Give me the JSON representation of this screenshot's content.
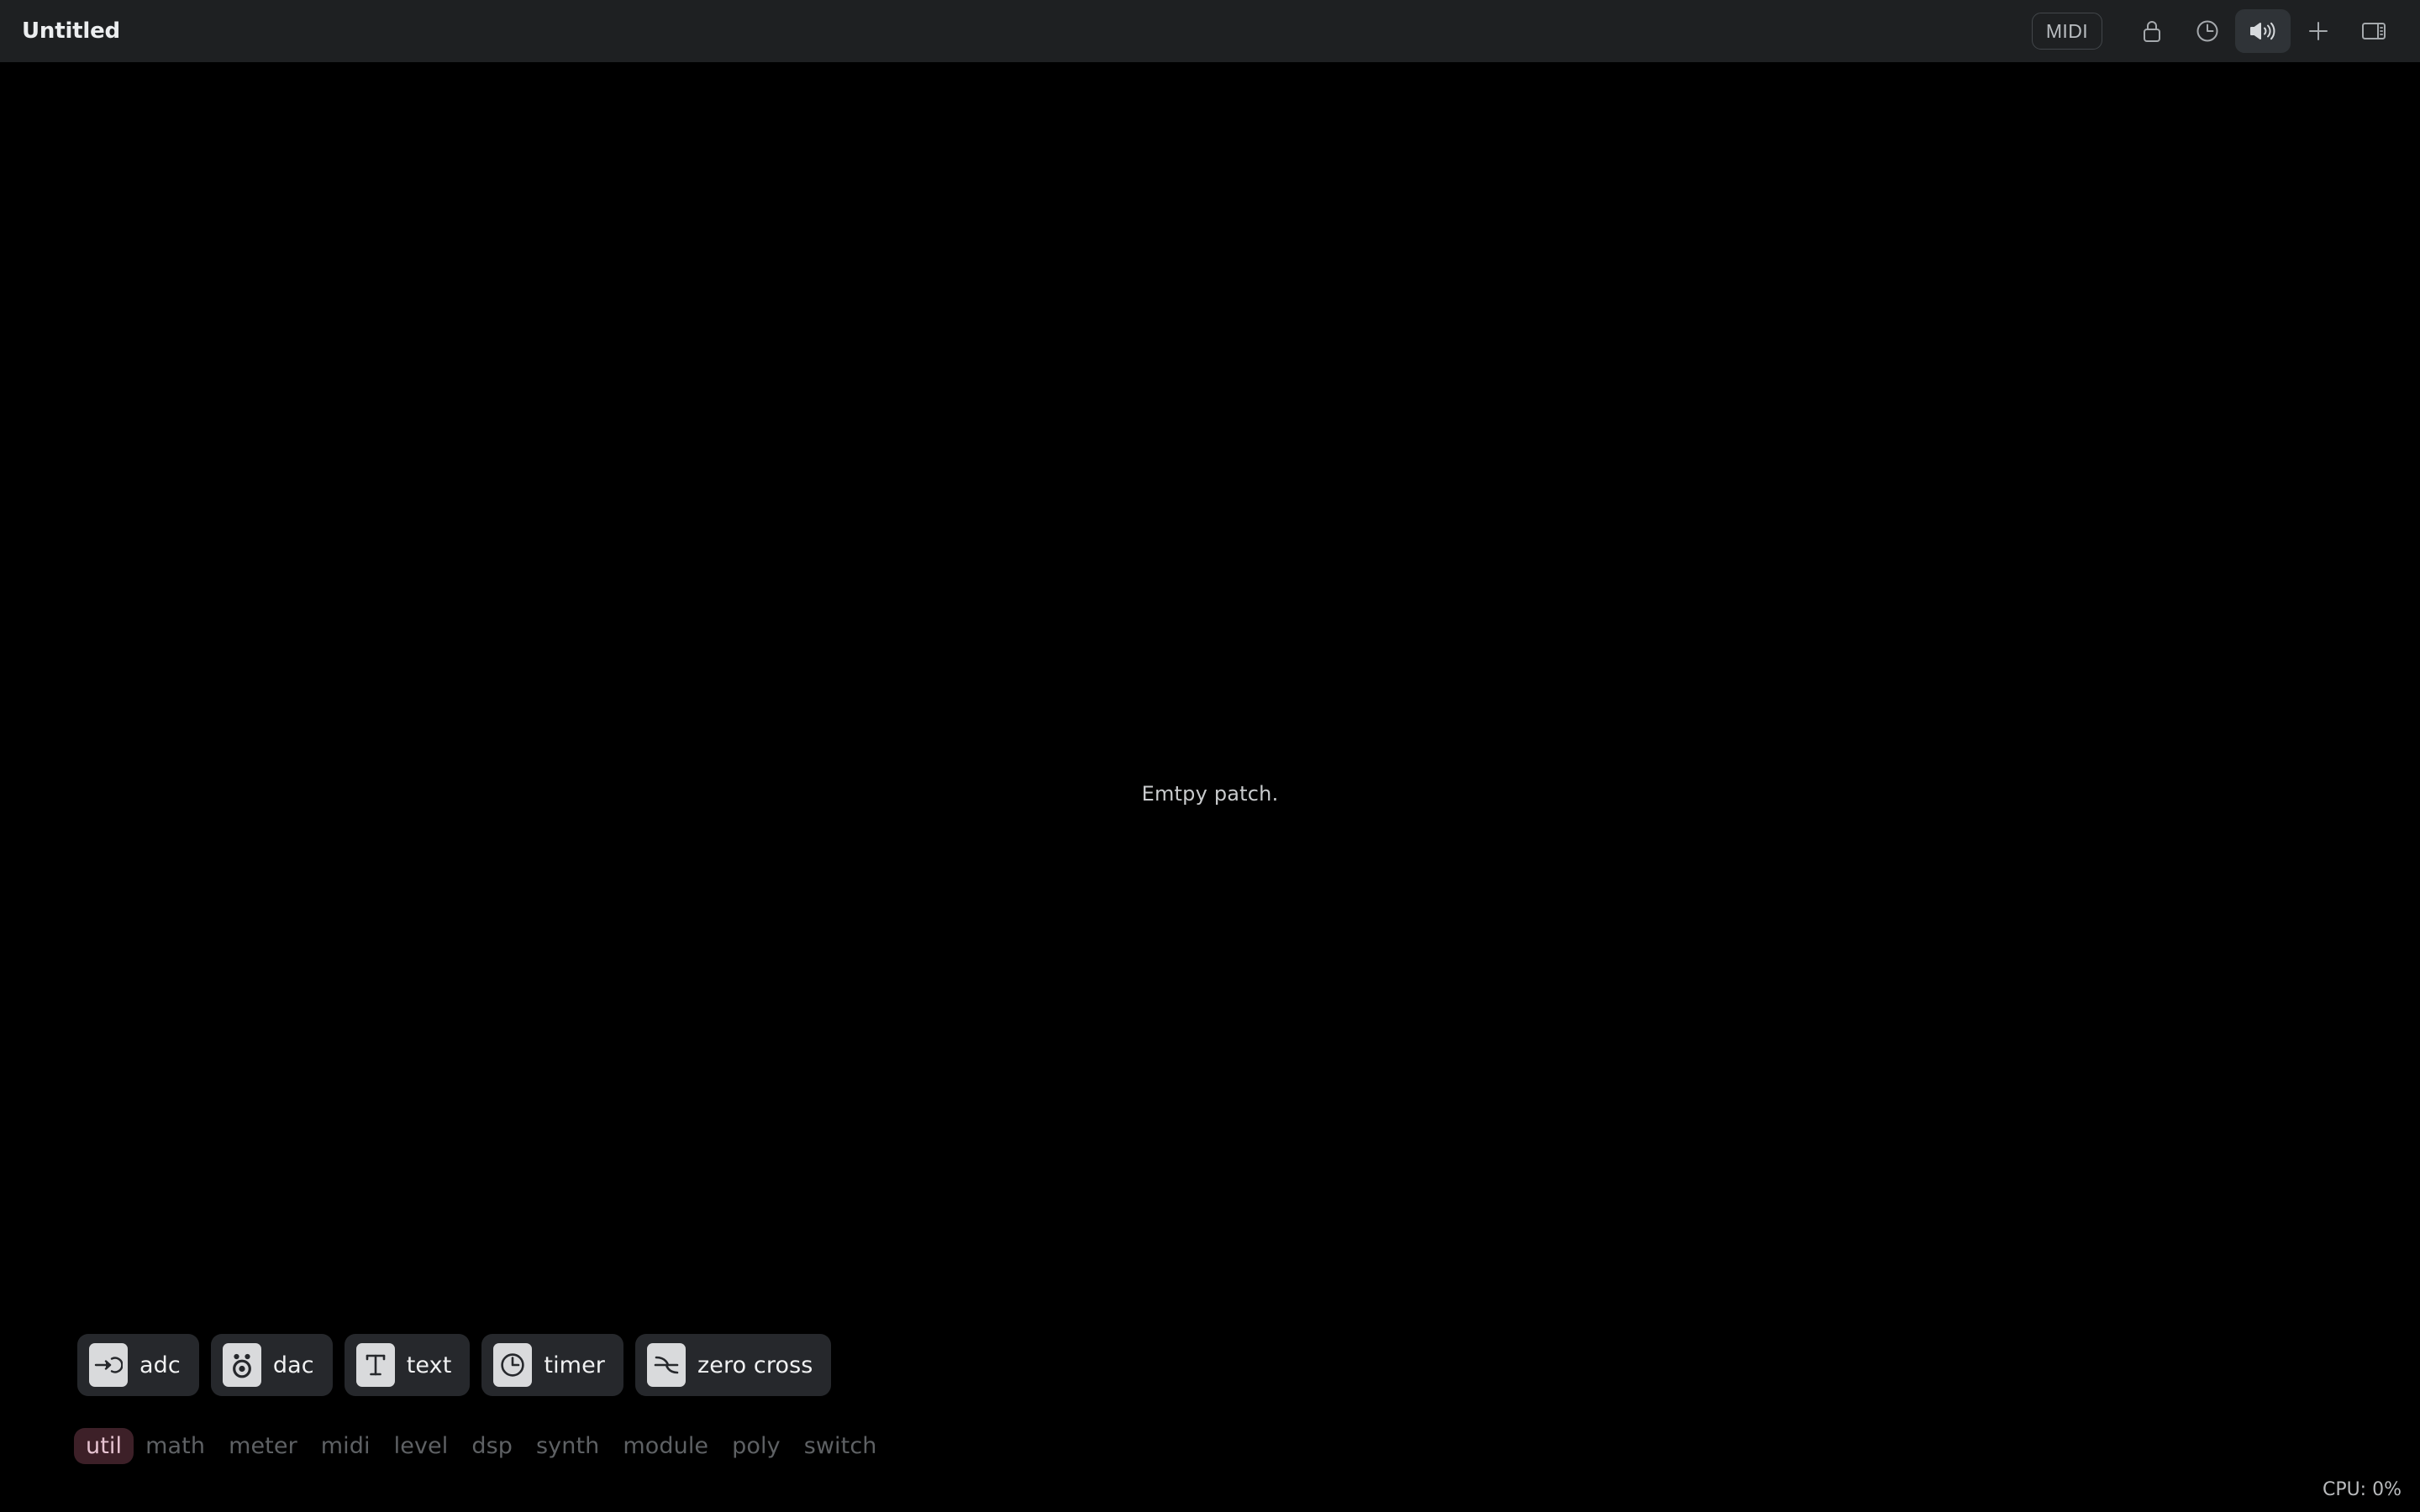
{
  "window": {
    "title": "Untitled"
  },
  "toolbar": {
    "midi_label": "MIDI",
    "items": [
      {
        "name": "midi-button",
        "icon": "midi-text",
        "active": false
      },
      {
        "name": "lock-button",
        "icon": "lock-icon",
        "active": false
      },
      {
        "name": "clock-button",
        "icon": "clock-icon",
        "active": false
      },
      {
        "name": "audio-button",
        "icon": "speaker-icon",
        "active": true
      },
      {
        "name": "add-button",
        "icon": "plus-icon",
        "active": false
      },
      {
        "name": "toggle-sidebar-button",
        "icon": "sidebar-panel-icon",
        "active": false
      }
    ]
  },
  "canvas": {
    "empty_message": "Emtpy patch."
  },
  "palette": {
    "nodes": [
      {
        "label": "adc",
        "icon": "adc-input-icon"
      },
      {
        "label": "dac",
        "icon": "dac-speaker-icon"
      },
      {
        "label": "text",
        "icon": "text-t-icon"
      },
      {
        "label": "timer",
        "icon": "timer-clock-icon"
      },
      {
        "label": "zero cross",
        "icon": "zero-cross-wave-icon"
      }
    ],
    "categories": [
      {
        "label": "util",
        "active": true
      },
      {
        "label": "math",
        "active": false
      },
      {
        "label": "meter",
        "active": false
      },
      {
        "label": "midi",
        "active": false
      },
      {
        "label": "level",
        "active": false
      },
      {
        "label": "dsp",
        "active": false
      },
      {
        "label": "synth",
        "active": false
      },
      {
        "label": "module",
        "active": false
      },
      {
        "label": "poly",
        "active": false
      },
      {
        "label": "switch",
        "active": false
      }
    ]
  },
  "status": {
    "cpu": "CPU: 0%"
  },
  "colors": {
    "titlebar_bg": "#1e2022",
    "canvas_bg": "#000000",
    "node_btn_bg": "#26282c",
    "node_icon_bg": "#d9dadc",
    "active_category_bg": "#3d2028",
    "active_category_fg": "#e7c4d2",
    "category_fg": "#5e6164",
    "toolbar_active_bg": "#2f3337"
  }
}
